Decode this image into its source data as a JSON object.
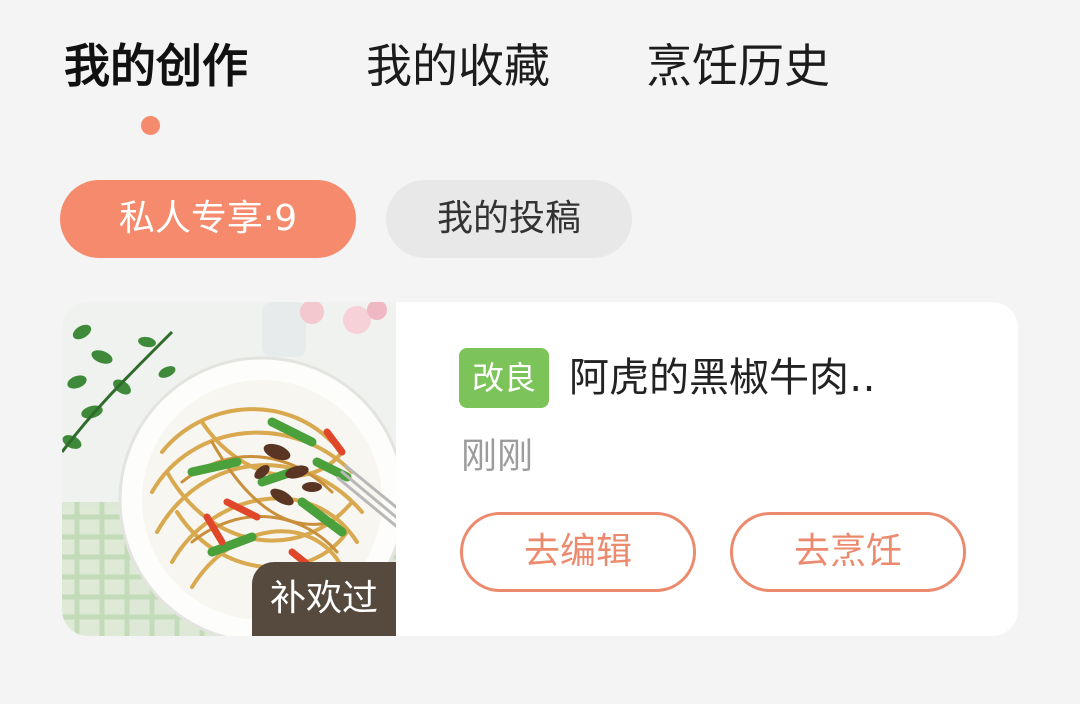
{
  "tabs": [
    {
      "label": "我的创作",
      "active": true
    },
    {
      "label": "我的收藏",
      "active": false
    },
    {
      "label": "烹饪历史",
      "active": false
    }
  ],
  "filters": {
    "private": "私人专享·9",
    "submissions": "我的投稿"
  },
  "recipe": {
    "tag": "改良",
    "title": "阿虎的黑椒牛肉‥",
    "time": "刚刚",
    "image_badge": "补欢过",
    "image_icon": "spaghetti-plate-photo",
    "edit_label": "去编辑",
    "cook_label": "去烹饪"
  },
  "colors": {
    "accent": "#f58a6c",
    "tag_green": "#7cc35a",
    "background": "#f4f4f4"
  }
}
